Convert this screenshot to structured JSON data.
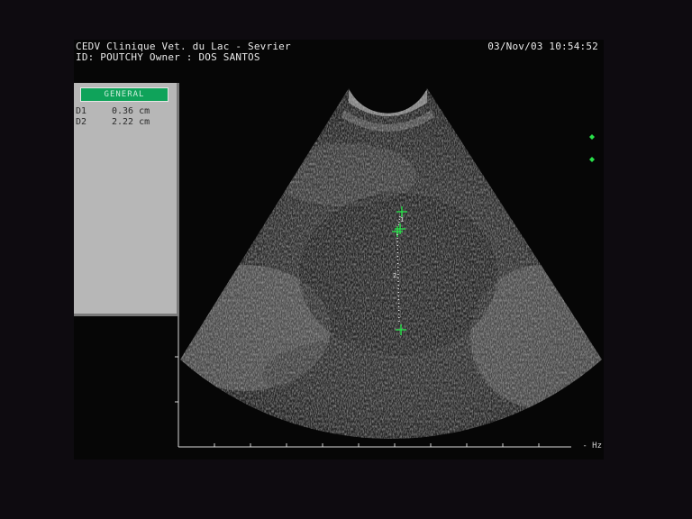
{
  "header": {
    "clinic": "CEDV Clinique Vet. du Lac - Sevrier",
    "patient_line": "ID: POUTCHY Owner : DOS SANTOS",
    "datetime": "03/Nov/03 10:54:52"
  },
  "measurement_panel": {
    "mode_label": "GENERAL",
    "rows": [
      {
        "label": "D1",
        "value": "0.36 cm"
      },
      {
        "label": "D2",
        "value": "2.22 cm"
      }
    ]
  },
  "calipers": [
    {
      "label": "1"
    },
    {
      "label": "2"
    }
  ],
  "axis": {
    "freq_label": "- Hz"
  },
  "colors": {
    "caliper": "#29e04a",
    "mode_button": "#0fa35a",
    "panel": "#b7b7b7"
  }
}
